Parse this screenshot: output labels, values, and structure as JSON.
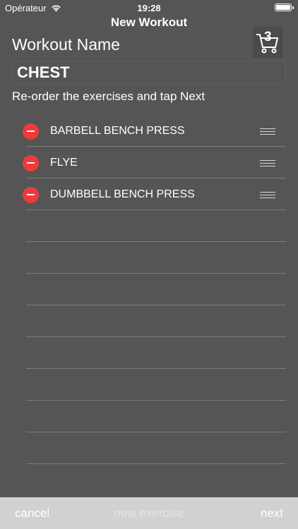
{
  "status": {
    "carrier": "Opérateur",
    "time": "19:28"
  },
  "nav": {
    "title": "New Workout",
    "cart_count": "3"
  },
  "form": {
    "label": "Workout Name",
    "name_value": "CHEST",
    "instruction": "Re-order the exercises and tap Next"
  },
  "exercises": [
    {
      "name": "BARBELL BENCH PRESS"
    },
    {
      "name": "FLYE"
    },
    {
      "name": "DUMBBELL BENCH PRESS"
    }
  ],
  "toolbar": {
    "cancel": "cancel",
    "new_exercise": "new exercise",
    "next": "next"
  },
  "colors": {
    "background": "#555555",
    "delete": "#f03a3a",
    "toolbar": "#d1d1d1"
  }
}
